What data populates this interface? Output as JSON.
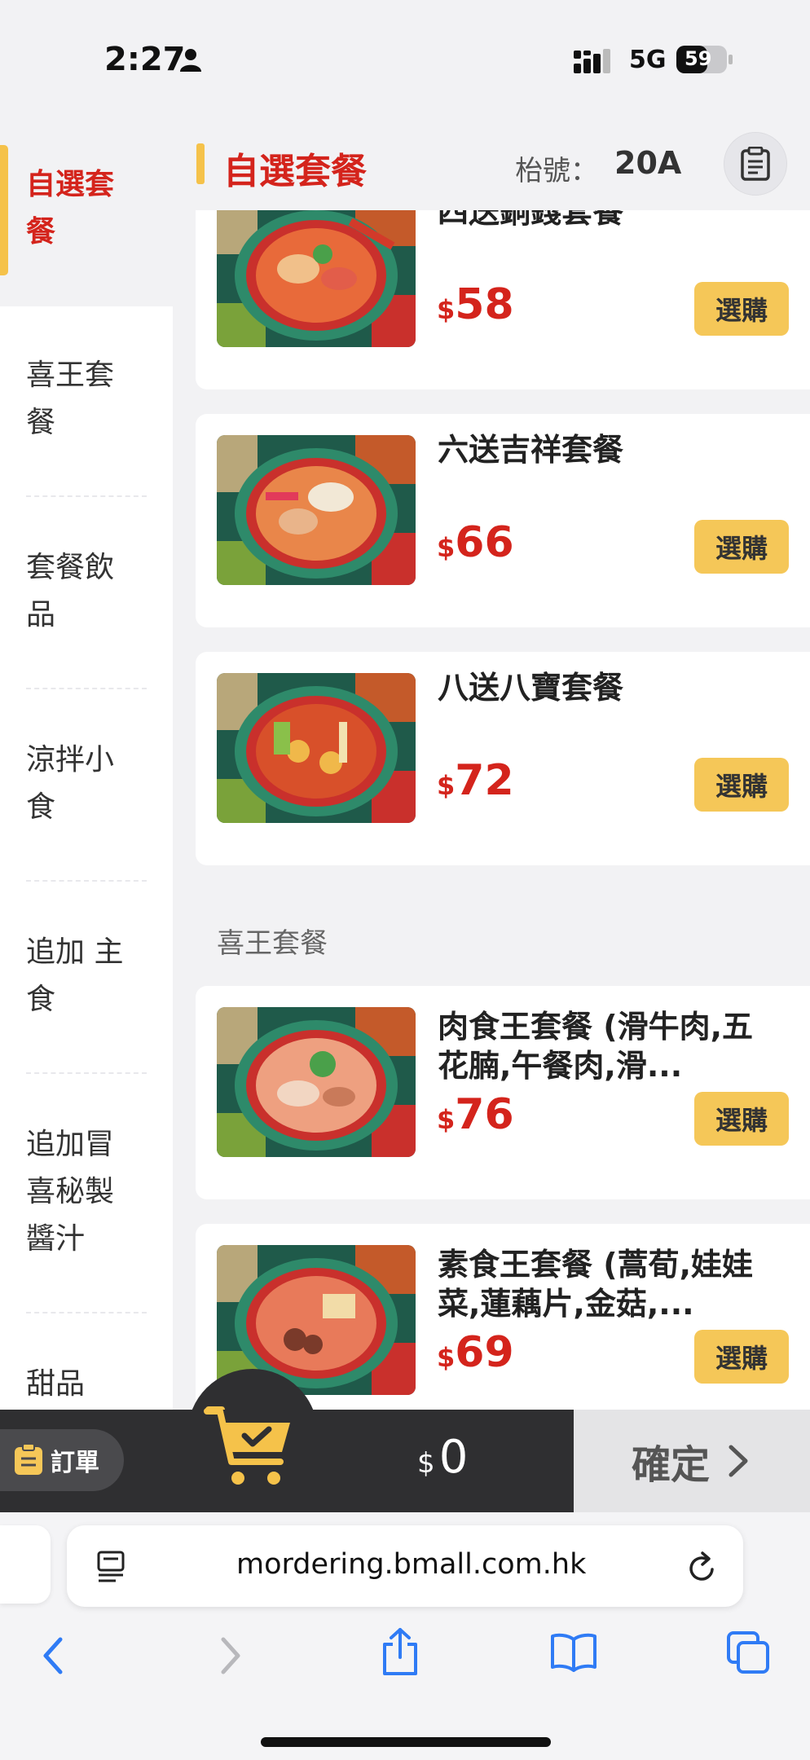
{
  "status_bar": {
    "time": "2:27",
    "network": "5G",
    "battery": "59"
  },
  "header": {
    "title": "自選套餐",
    "table_label": "枱號：",
    "table_number": "20A"
  },
  "sidebar": {
    "items": [
      {
        "label": "自選套餐"
      },
      {
        "label": "喜王套餐"
      },
      {
        "label": "套餐飲品"
      },
      {
        "label": "涼拌小食"
      },
      {
        "label": "追加 主食"
      },
      {
        "label": "追加冒喜秘製醬汁"
      },
      {
        "label": "甜品"
      }
    ]
  },
  "menu": {
    "currency": "$",
    "buy_label": "選購",
    "section_title": "喜王套餐",
    "items": [
      {
        "name": "四送銅錢套餐",
        "price": "58"
      },
      {
        "name": "六送吉祥套餐",
        "price": "66"
      },
      {
        "name": "八送八寶套餐",
        "price": "72"
      },
      {
        "name": "肉食王套餐 (滑牛肉,五花腩,午餐肉,滑...",
        "price": "76"
      },
      {
        "name": "素食王套餐 (蒿荀,娃娃菜,蓮藕片,金菇,...",
        "price": "69"
      }
    ]
  },
  "cart": {
    "order_label": "訂單",
    "currency": "$",
    "total": "0",
    "confirm_label": "確定"
  },
  "browser": {
    "url": "mordering.bmall.com.hk"
  },
  "colors": {
    "accent_red": "#d4241c",
    "accent_yellow": "#f5c758",
    "cart_dark": "#2f2f31"
  },
  "icons": [
    "person-icon",
    "signal-icon",
    "battery-icon",
    "receipt-icon",
    "cart-icon",
    "order-list-icon",
    "chevron-right-icon",
    "page-menu-icon",
    "reload-icon",
    "back-icon",
    "forward-icon",
    "share-icon",
    "bookmarks-icon",
    "tabs-icon"
  ]
}
